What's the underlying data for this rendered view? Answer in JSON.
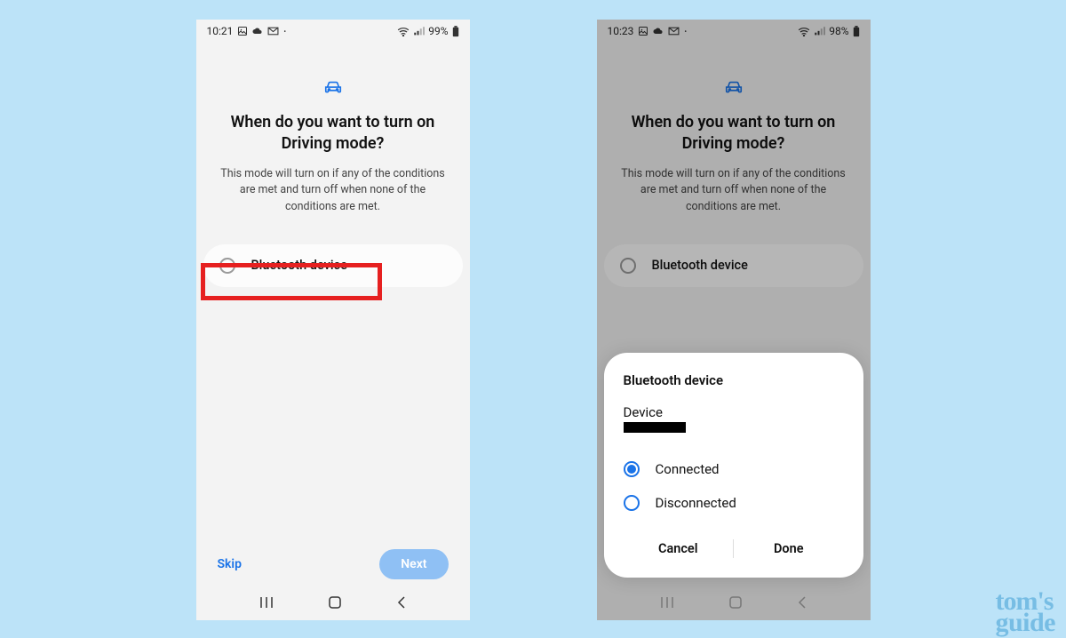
{
  "left": {
    "status": {
      "time": "10:21",
      "battery": "99%"
    },
    "title": "When do you want to turn on Driving mode?",
    "subtitle": "This mode will turn on if any of the conditions are met and turn off when none of the conditions are met.",
    "option": "Bluetooth device",
    "skip": "Skip",
    "next": "Next"
  },
  "right": {
    "status": {
      "time": "10:23",
      "battery": "98%"
    },
    "title": "When do you want to turn on Driving mode?",
    "subtitle": "This mode will turn on if any of the conditions are met and turn off when none of the conditions are met.",
    "option": "Bluetooth device",
    "dialog": {
      "title": "Bluetooth device",
      "device_label": "Device",
      "connected": "Connected",
      "disconnected": "Disconnected",
      "cancel": "Cancel",
      "done": "Done"
    }
  },
  "watermark": {
    "line1": "tom's",
    "line2": "guide"
  }
}
